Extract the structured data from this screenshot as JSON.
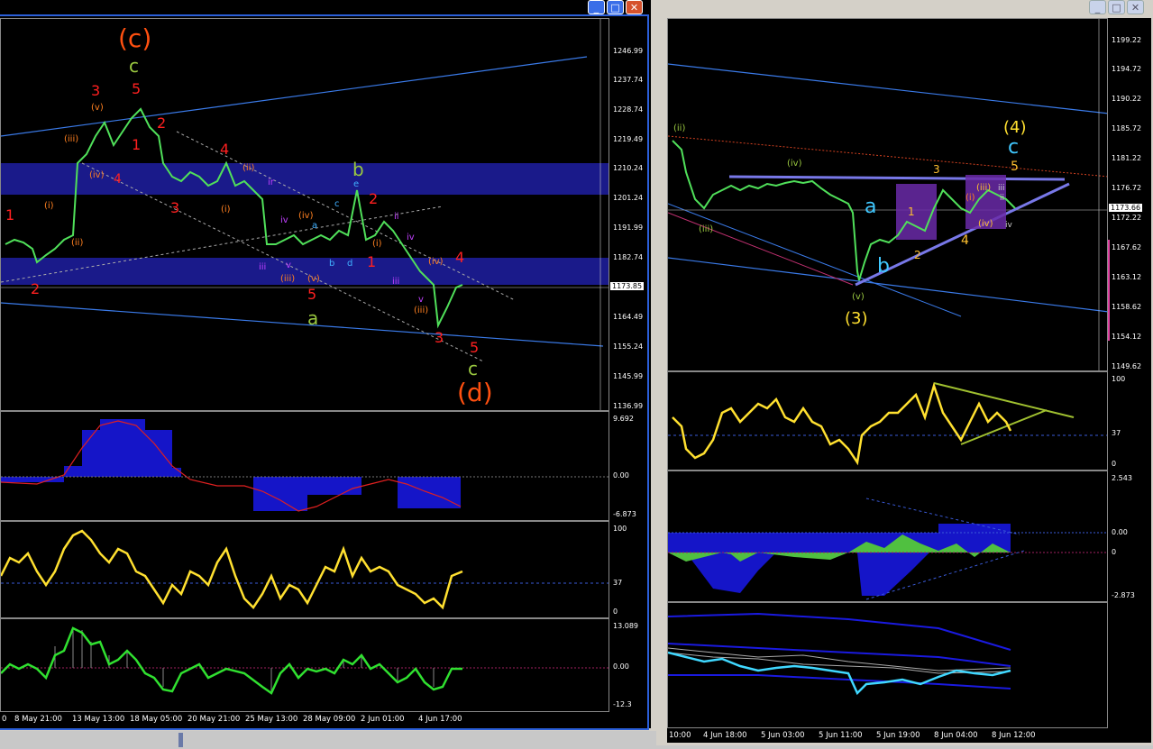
{
  "left_chart": {
    "buttons": {
      "minimize": "_",
      "maximize": "□",
      "close": "✕"
    },
    "price_axis": [
      "1246.99",
      "1237.74",
      "1228.74",
      "1219.49",
      "1210.24",
      "1201.24",
      "1191.99",
      "1182.74",
      "1173.85",
      "1164.49",
      "1155.24",
      "1145.99",
      "1136.99"
    ],
    "current_price": "1173.85",
    "macd_axis": [
      "9.692",
      "0.00",
      "-6.873"
    ],
    "rsi_axis": [
      "100",
      "37",
      "0"
    ],
    "osc_axis": [
      "13.089",
      "0.00",
      "-12.3"
    ],
    "time_axis": [
      "0",
      "8 May 21:00",
      "13 May 13:00",
      "18 May 05:00",
      "20 May 21:00",
      "25 May 13:00",
      "28 May 09:00",
      "2 Jun 01:00",
      "4 Jun 17:00"
    ],
    "wave_labels": {
      "c_paren": "(c)",
      "c_green": "c",
      "top_3": "3",
      "top_5": "5",
      "r1": "1",
      "r2": "2",
      "v_paren": "(v)",
      "iii_paren": "(iii)",
      "iv_paren": "(iv)",
      "ii_paren": "(ii)",
      "i_paren": "(i)",
      "red4a": "4",
      "red4b": "4",
      "red3a": "3",
      "red1": "1",
      "red2": "2",
      "red1b": "1",
      "red2b": "2",
      "b_green": "b",
      "e_lbl": "e",
      "c_small": "c",
      "a_small": "a",
      "b_small": "b",
      "d_small": "d",
      "iv_small": "iv",
      "v_small": "v",
      "iii_small": "iii",
      "iv2": "(iv)",
      "v2": "(v)",
      "iii2": "(iii)",
      "ii2": "(ii)",
      "i2": "(i)",
      "red5": "5",
      "a_green": "a",
      "red3b": "3",
      "red5b": "5",
      "c_green2": "c",
      "d_paren": "(d)",
      "iv3": "(iv)",
      "red4c": "4",
      "ii3": "ii",
      "iv4": "iv",
      "iii3": "iii",
      "v3": "v",
      "iii4": "(iii)",
      "ir": "ir"
    }
  },
  "right_chart": {
    "buttons": {
      "minimize": "_",
      "maximize": "□",
      "close": "✕"
    },
    "price_axis": [
      "1199.22",
      "1194.72",
      "1190.22",
      "1185.72",
      "1181.22",
      "1176.72",
      "1173.66",
      "1172.22",
      "1167.62",
      "1163.12",
      "1158.62",
      "1154.12",
      "1149.62"
    ],
    "current_price": "1173.66",
    "rsi_axis": [
      "100",
      "37",
      "0"
    ],
    "macd_axis": [
      "2.543",
      "0.00",
      "0",
      "-2.873"
    ],
    "time_axis": [
      "10:00",
      "4 Jun 18:00",
      "5 Jun 03:00",
      "5 Jun 11:00",
      "5 Jun 19:00",
      "8 Jun 04:00",
      "8 Jun 12:00"
    ],
    "wave_labels": {
      "four_paren": "(4)",
      "c_cyan": "c",
      "five_y": "5",
      "three_y": "3",
      "iv_paren": "(iv)",
      "ii_paren": "(ii)",
      "iii_paren": "(iii)",
      "a_cyan": "a",
      "b_cyan": "b",
      "v_paren": "(v)",
      "three_paren": "(3)",
      "one_y": "1",
      "two_y": "2",
      "four_y": "4",
      "i_paren": "(i)",
      "iii2": "(iii)",
      "iv2": "(iv)",
      "ii_small": "ii",
      "iv_small": "iv",
      "iii_small": "iii"
    }
  },
  "colors": {
    "band": "#1a1a8a",
    "candle": "#50e05a",
    "wave_red": "#ff2020",
    "wave_orange": "#ff8020",
    "yellow": "#ffe030",
    "blue_line": "#3a7ae8",
    "macd": "#1515c8"
  }
}
